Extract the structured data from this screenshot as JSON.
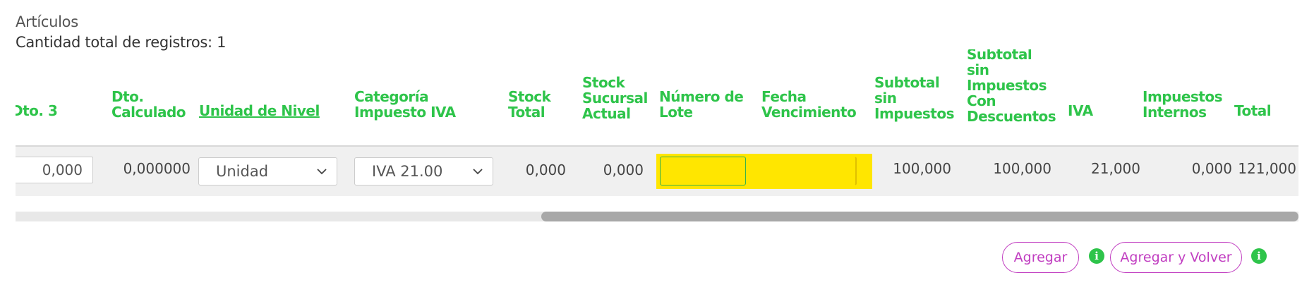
{
  "section": {
    "title": "Artículos",
    "record_count_label": "Cantidad total de registros: 1"
  },
  "table": {
    "headers": {
      "dto3": "Dto. 3",
      "dto_calculado": [
        "Dto.",
        "Calculado"
      ],
      "unidad_nivel": "Unidad de Nivel",
      "categoria_iva": [
        "Categoría",
        "Impuesto IVA"
      ],
      "stock_total": [
        "Stock",
        "Total"
      ],
      "stock_sucursal": [
        "Stock",
        "Sucursal",
        "Actual"
      ],
      "numero_lote": [
        "Número de",
        "Lote"
      ],
      "fecha_vencimiento": [
        "Fecha",
        "Vencimiento"
      ],
      "subtotal_sin_impuestos": [
        "Subtotal",
        "sin",
        "Impuestos"
      ],
      "subtotal_con_descuentos": [
        "Subtotal",
        "sin",
        "Impuestos",
        "Con",
        "Descuentos"
      ],
      "iva": "IVA",
      "impuestos_internos": [
        "Impuestos",
        "Internos"
      ],
      "total": "Total"
    },
    "row": {
      "dto3_value": "0,000",
      "dto_calculado": "0,000000",
      "unidad_nivel": "Unidad",
      "categoria_iva": "IVA 21.00",
      "stock_total": "0,000",
      "stock_sucursal": "0,000",
      "numero_lote": "",
      "fecha_vencimiento": "",
      "subtotal_sin_impuestos": "100,000",
      "subtotal_con_descuentos": "100,000",
      "iva": "21,000",
      "impuestos_internos": "0,000",
      "total": "121,000"
    }
  },
  "scrollbar": {
    "position_fraction": 0.41,
    "thumb_fraction": 0.59
  },
  "actions": {
    "agregar": "Agregar",
    "agregar_y_volver": "Agregar y Volver"
  },
  "icons": {
    "info": "info-icon",
    "dropdown": "chevron-down-icon"
  },
  "colors": {
    "header_green": "#2ec44a",
    "button_magenta": "#c13ec1",
    "highlight_yellow": "#ffe600"
  }
}
